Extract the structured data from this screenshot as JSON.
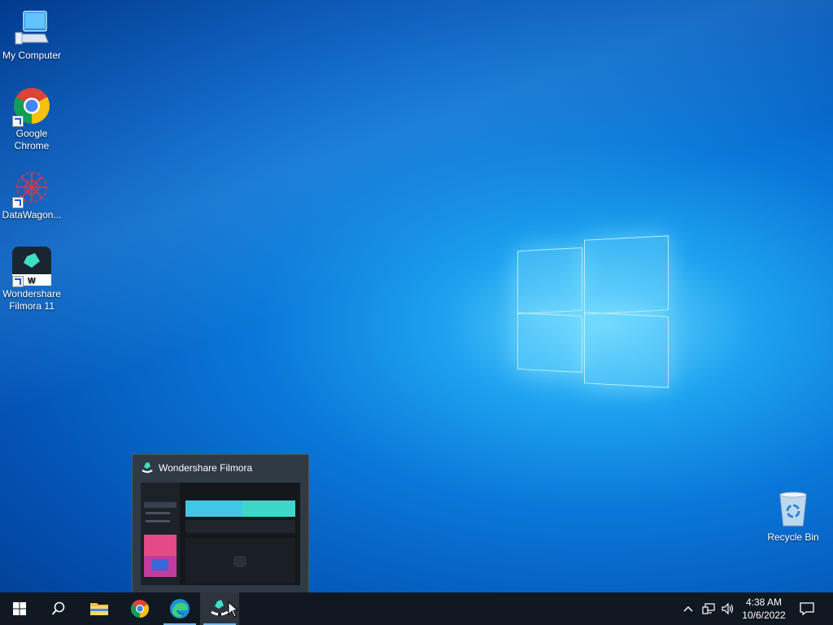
{
  "desktop": {
    "icons": [
      {
        "label_lines": [
          "My Computer"
        ]
      },
      {
        "label_lines": [
          "Google",
          "Chrome"
        ]
      },
      {
        "label_lines": [
          "DataWagon..."
        ]
      },
      {
        "label_lines": [
          "Wondershare",
          "Filmora 11"
        ]
      },
      {
        "label_lines": [
          "Recycle Bin"
        ]
      }
    ]
  },
  "preview": {
    "title": "Wondershare Filmora"
  },
  "taskbar": {
    "buttons": [
      "start-icon",
      "search-icon",
      "file-explorer-icon",
      "chrome-icon",
      "edge-icon",
      "filmora-icon"
    ],
    "active": "filmora-icon"
  },
  "tray": {
    "icons": [
      "chevron-up-icon",
      "network-icon",
      "volume-icon",
      "notification-icon"
    ],
    "time": "4:38 AM",
    "date": "10/6/2022"
  },
  "colors": {
    "taskbar": "#101822",
    "accent": "#76b9ed"
  }
}
